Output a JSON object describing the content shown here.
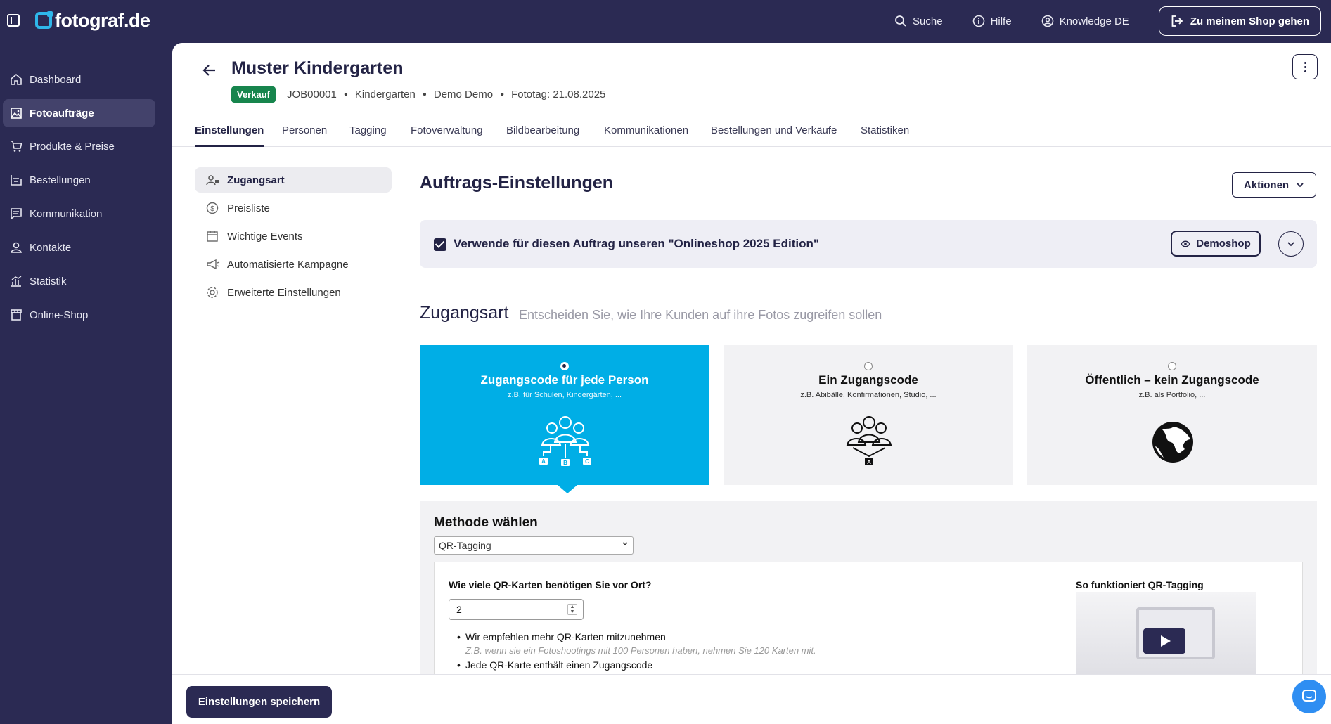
{
  "brand": {
    "logo_text": "fotograf.de",
    "accent": "#2fb7ea",
    "nav_bg": "#2b2a53"
  },
  "topbar": {
    "search_label": "Suche",
    "help_label": "Hilfe",
    "account_label": "Knowledge DE",
    "shop_button_label": "Zu meinem Shop gehen"
  },
  "sidebar": {
    "items": [
      {
        "label": "Dashboard",
        "icon": "home-icon"
      },
      {
        "label": "Fotoaufträge",
        "icon": "image-icon",
        "active": true
      },
      {
        "label": "Produkte & Preise",
        "icon": "cart-icon"
      },
      {
        "label": "Bestellungen",
        "icon": "box-icon"
      },
      {
        "label": "Kommunikation",
        "icon": "message-icon"
      },
      {
        "label": "Kontakte",
        "icon": "person-icon"
      },
      {
        "label": "Statistik",
        "icon": "chart-icon"
      },
      {
        "label": "Online-Shop",
        "icon": "store-icon"
      }
    ]
  },
  "header": {
    "title": "Muster Kindergarten",
    "badge": "Verkauf",
    "job_id": "JOB00001",
    "category": "Kindergarten",
    "customer": "Demo Demo",
    "photo_day": "Fototag: 21.08.2025"
  },
  "tabs": [
    {
      "label": "Einstellungen",
      "active": true
    },
    {
      "label": "Personen"
    },
    {
      "label": "Tagging"
    },
    {
      "label": "Fotoverwaltung"
    },
    {
      "label": "Bildbearbeitung"
    },
    {
      "label": "Kommunikationen"
    },
    {
      "label": "Bestellungen und Verkäufe"
    },
    {
      "label": "Statistiken"
    }
  ],
  "subnav": [
    {
      "label": "Zugangsart",
      "active": true
    },
    {
      "label": "Preisliste"
    },
    {
      "label": "Wichtige Events"
    },
    {
      "label": "Automatisierte Kampagne"
    },
    {
      "label": "Erweiterte Einstellungen"
    }
  ],
  "settings": {
    "title": "Auftrags-Einstellungen",
    "actions_label": "Aktionen",
    "shop_checkbox_label": "Verwende für diesen Auftrag unseren \"Onlineshop 2025 Edition\"",
    "shop_checked": true,
    "demoshop_label": "Demoshop"
  },
  "access": {
    "title": "Zugangsart",
    "subtitle": "Entscheiden Sie, wie Ihre Kunden auf ihre Fotos zugreifen sollen",
    "cards": [
      {
        "title": "Zugangscode für jede Person",
        "sub": "z.B. für Schulen, Kindergärten, ...",
        "selected": true,
        "color": "#00aee6"
      },
      {
        "title": "Ein Zugangscode",
        "sub": "z.B. Abibälle, Konfirmationen, Studio, ..."
      },
      {
        "title": "Öffentlich – kein Zugangscode",
        "sub": "z.B. als Portfolio, ..."
      }
    ]
  },
  "method": {
    "title": "Methode wählen",
    "selected": "QR-Tagging",
    "question": "Wie viele QR-Karten benötigen Sie vor Ort?",
    "count_value": "2",
    "bullet_1": "Wir empfehlen mehr QR-Karten mitzunehmen",
    "hint_1": "Z.B. wenn sie ein Fotoshootings mit 100 Personen haben, nehmen Sie 120 Karten mit.",
    "bullet_2": "Jede QR-Karte enthält einen Zugangscode",
    "video_title": "So funktioniert QR-Tagging"
  },
  "footer": {
    "save_label": "Einstellungen speichern"
  }
}
